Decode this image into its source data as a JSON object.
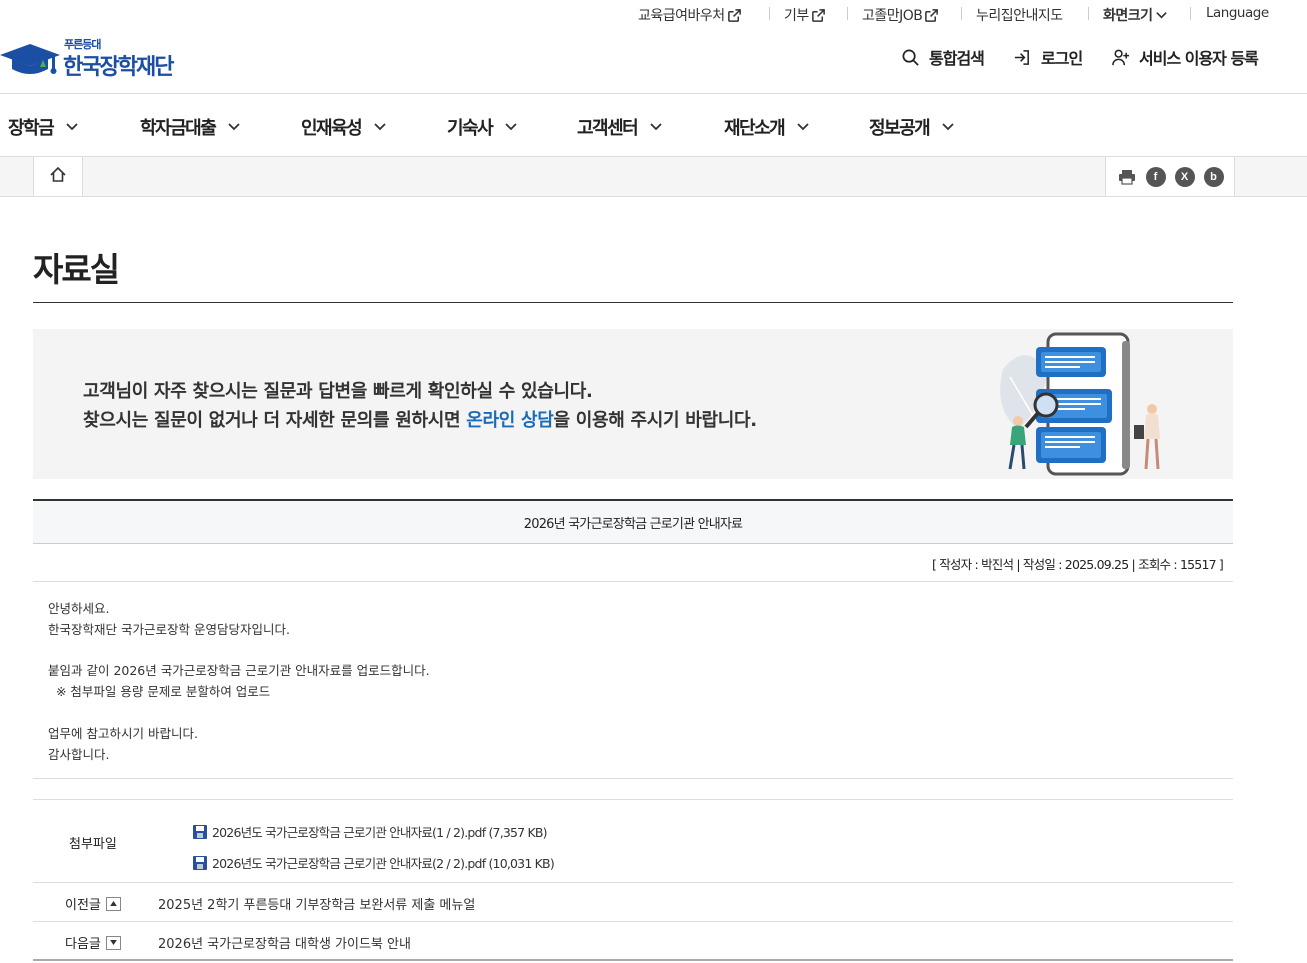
{
  "util": {
    "voucher": "교육급여바우처",
    "donate": "기부",
    "job": "고졸만JOB",
    "map": "누리집안내지도",
    "font_size": "화면크기",
    "language": "Language"
  },
  "logo": {
    "sub": "푸른등대",
    "main": "한국장학재단"
  },
  "header": {
    "search": "통합검색",
    "login": "로그인",
    "register": "서비스 이용자 등록"
  },
  "gnb": [
    "장학금",
    "학자금대출",
    "인재육성",
    "기숙사",
    "고객센터",
    "재단소개",
    "정보공개"
  ],
  "share": {
    "facebook": "f",
    "x": "X",
    "blog": "b"
  },
  "page": {
    "title": "자료실"
  },
  "banner": {
    "line1": "고객님이 자주 찾으시는 질문과 답변을 빠르게 확인하실 수 있습니다.",
    "line2_before": "찾으시는 질문이 없거나 더 자세한 문의를 원하시면 ",
    "line2_link": "온라인 상담",
    "line2_after": "을 이용해 주시기 바랍니다."
  },
  "post": {
    "title": "2026년 국가근로장학금 근로기관 안내자료",
    "meta": "[ 작성자 : 박진석 | 작성일 : 2025.09.25 | 조회수 : 15517 ]",
    "body": [
      "안녕하세요.",
      "한국장학재단 국가근로장학 운영담당자입니다.",
      "",
      "붙임과 같이 2026년 국가근로장학금 근로기관 안내자료를 업로드합니다.",
      "  ※ 첨부파일 용량 문제로 분할하여 업로드",
      "",
      "업무에 참고하시기 바랍니다.",
      "감사합니다."
    ],
    "attachment_label": "첨부파일",
    "files": [
      "2026년도 국가근로장학금 근로기관 안내자료(1 / 2).pdf (7,357 KB)",
      "2026년도 국가근로장학금 근로기관 안내자료(2 / 2).pdf (10,031 KB)"
    ]
  },
  "nav": {
    "prev_label": "이전글",
    "prev_title": "2025년 2학기 푸른등대 기부장학금 보완서류 제출 메뉴얼",
    "next_label": "다음글",
    "next_title": "2026년 국가근로장학금 대학생 가이드북 안내"
  }
}
